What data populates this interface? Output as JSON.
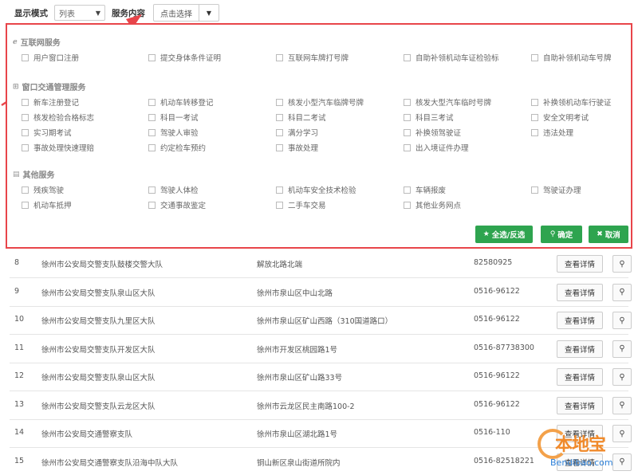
{
  "toolbar": {
    "display_mode_label": "显示模式",
    "display_mode_value": "列表",
    "service_content_label": "服务内容",
    "picker_placeholder": "点击选择"
  },
  "sections": [
    {
      "title": "互联网服务",
      "icon": "ie-icon",
      "items": [
        "用户窗口注册",
        "提交身体条件证明",
        "互联网车牌打号牌",
        "自助补领机动车证检验标",
        "自助补领机动车号牌"
      ]
    },
    {
      "title": "窗口交通管理服务",
      "icon": "windows-icon",
      "items": [
        "新车注册登记",
        "机动车转移登记",
        "核发小型汽车临牌号牌",
        "核发大型汽车临时号牌",
        "补换领机动车行驶证",
        "核发检验合格标志",
        "科目一考试",
        "科目二考试",
        "科目三考试",
        "安全文明考试",
        "实习期考试",
        "驾驶人审验",
        "满分学习",
        "补换领驾驶证",
        "违法处理",
        "事故处理快速理赔",
        "约定检车预约",
        "事故处理",
        "出入境证件办理"
      ]
    },
    {
      "title": "其他服务",
      "icon": "list-icon",
      "items": [
        "残疾驾驶",
        "驾驶人体检",
        "机动车安全技术检验",
        "车辆报废",
        "驾驶证办理",
        "机动车抵押",
        "交通事故鉴定",
        "二手车交易",
        "其他业务网点"
      ]
    }
  ],
  "buttons": {
    "select_all": "全选/反选",
    "confirm": "确定",
    "cancel": "取消"
  },
  "rows": [
    {
      "no": "8",
      "name": "徐州市公安局交警支队鼓楼交警大队",
      "address": "解放北路北端",
      "phone": "82580925",
      "detail": "查看详情"
    },
    {
      "no": "9",
      "name": "徐州市公安局交警支队泉山区大队",
      "address": "徐州市泉山区中山北路",
      "phone": "0516-96122",
      "detail": "查看详情"
    },
    {
      "no": "10",
      "name": "徐州市公安局交警支队九里区大队",
      "address": "徐州市泉山区矿山西路（310国道路口）",
      "phone": "0516-96122",
      "detail": "查看详情"
    },
    {
      "no": "11",
      "name": "徐州市公安局交警支队开发区大队",
      "address": "徐州市开发区桃园路1号",
      "phone": "0516-87738300",
      "detail": "查看详情"
    },
    {
      "no": "12",
      "name": "徐州市公安局交警支队泉山区大队",
      "address": "徐州市泉山区矿山路33号",
      "phone": "0516-96122",
      "detail": "查看详情"
    },
    {
      "no": "13",
      "name": "徐州市公安局交警支队云龙区大队",
      "address": "徐州市云龙区民主南路100-2",
      "phone": "0516-96122",
      "detail": "查看详情"
    },
    {
      "no": "14",
      "name": "徐州市公安局交通警察支队",
      "address": "徐州市泉山区湖北路1号",
      "phone": "0516-110",
      "detail": "查看详情"
    },
    {
      "no": "15",
      "name": "徐州市公安局交通警察支队沿海中队大队",
      "address": "铜山新区泉山街道所院内",
      "phone": "0516-82518221",
      "detail": "查看详情"
    }
  ],
  "watermark": {
    "text": "本地宝",
    "url": "Bendibao.com"
  },
  "colors": {
    "highlight_border": "#e8454a",
    "button_green": "#2ea44f"
  }
}
